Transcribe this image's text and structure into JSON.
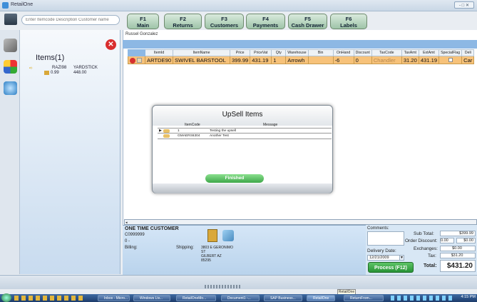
{
  "window": {
    "title": "RetailOne",
    "controls": "- □ ✕"
  },
  "search": {
    "placeholder": "Enter Itemcode Description Customer name"
  },
  "fkeys": [
    {
      "key": "F1",
      "label": "Main"
    },
    {
      "key": "F2",
      "label": "Returns"
    },
    {
      "key": "F3",
      "label": "Customers"
    },
    {
      "key": "F4",
      "label": "Payments"
    },
    {
      "key": "F5",
      "label": "Cash Drawer"
    },
    {
      "key": "F6",
      "label": "Labels"
    }
  ],
  "left_panel": {
    "title": "Items(1)",
    "item_code": "RAZI98",
    "item_name": "YARDSTICK",
    "price": "0.99",
    "qty": "448.00"
  },
  "customer_name": "Russel Gonzalez",
  "grid": {
    "columns": [
      "ItemId",
      "ItemName",
      "Price",
      "PriceVat",
      "Qty",
      "Warehouse",
      "Bin",
      "OnHand",
      "Discount",
      "TaxCode",
      "TaxAmt",
      "ExtAmt",
      "SpecialFlag",
      "Deli"
    ],
    "row": [
      "ARTDE90",
      "SWIVEL BARSTOOL",
      "399.99",
      "431.19",
      "1",
      "Arrowh",
      "",
      "-6",
      "0",
      "Chandler",
      "31.20",
      "431.19",
      "",
      "Car"
    ]
  },
  "dialog": {
    "title": "UpSell Items",
    "columns": [
      "ItemCode",
      "Message"
    ],
    "rows": [
      {
        "code": "1",
        "message": "Testing the upsell"
      },
      {
        "code": "GMAERS6304",
        "message": "Another Test"
      }
    ],
    "finish_label": "Finished"
  },
  "customer": {
    "heading": "ONE TIME CUSTOMER",
    "id": "C0999999",
    "zero": "0 -",
    "billing_label": "Billing:",
    "shipping_label": "Shipping:",
    "address1": "3803 E GERONIMO",
    "address2": "ST",
    "address3": "GILBERT  AZ",
    "address4": "85295"
  },
  "totals": {
    "comments_label": "Comments:",
    "subtotal_label": "Sub Total:",
    "subtotal": "$399.99",
    "order_discount_label": "Order Discount:",
    "order_discount_pct": "0.00",
    "order_discount": "$0.00",
    "exchanges_label": "Exchanges:",
    "exchanges": "$0.00",
    "tax_label": "Tax:",
    "tax": "$31.20",
    "delivery_label": "Delivery Date:",
    "delivery_date": "12/21/2009",
    "process_label": "Process (F12)",
    "total_label": "Total:",
    "total": "$431.20"
  },
  "tooltip": "RetailOne",
  "taskbar": {
    "items": [
      "Inbox - Micro...",
      "Windows Liv...",
      "RetailOneMo...",
      "Document1 -...",
      "SAP Business...",
      "RetailOne",
      "ReturnFrom..."
    ],
    "clock": "4:15 PM"
  }
}
